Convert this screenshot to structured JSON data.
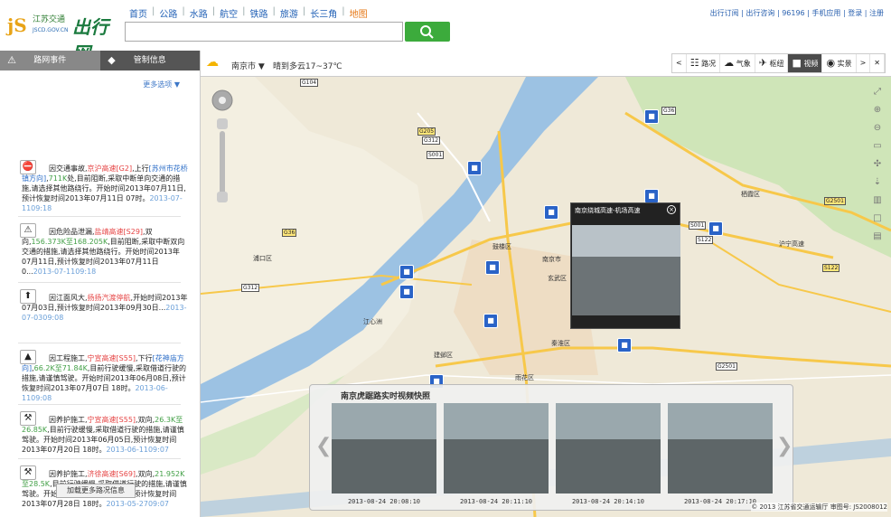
{
  "header": {
    "logo_text": "江苏交通",
    "logo_domain": "JSCD.GOV.CN",
    "logo_big": "出行网",
    "nav": [
      "首页",
      "公路",
      "水路",
      "航空",
      "铁路",
      "旅游",
      "长三角",
      "地图"
    ],
    "toplinks": "出行订阅 | 出行咨询 | 96196 | 手机应用 | 登录 | 注册"
  },
  "sidebar": {
    "tab_road_events": "路网事件",
    "tab_control_info": "管制信息",
    "more_options": "更多选项 ▼",
    "events": [
      {
        "parts": [
          {
            "t": "因交通事故,",
            "c": ""
          },
          {
            "t": "京沪高速[G2]",
            "c": "hl"
          },
          {
            "t": ",上行",
            "c": ""
          },
          {
            "t": "[苏州市花桥镇方向]",
            "c": "bl"
          },
          {
            "t": ",",
            "c": ""
          },
          {
            "t": "711K",
            "c": "gr"
          },
          {
            "t": "处,目前阻断,采取中断单向交通的措施,请选择其他路绕行。开始时间2013年07月11日,预计恢复时间2013年07月11日 07时。",
            "c": ""
          },
          {
            "t": "2013-07-1109:18",
            "c": "dt"
          }
        ]
      },
      {
        "parts": [
          {
            "t": "因危险品泄漏,",
            "c": ""
          },
          {
            "t": "盐靖高速[S29]",
            "c": "hl"
          },
          {
            "t": ",双向,",
            "c": ""
          },
          {
            "t": "156.373K至168.205K",
            "c": "gr"
          },
          {
            "t": ",目前阻断,采取中断双向交通的措施,请选择其他路绕行。开始时间2013年07月11日,预计恢复时间2013年07月11日 0...",
            "c": ""
          },
          {
            "t": "2013-07-1109:18",
            "c": "dt"
          }
        ]
      },
      {
        "parts": [
          {
            "t": "因江面风大,",
            "c": ""
          },
          {
            "t": "扬扬汽渡停航",
            "c": "hl"
          },
          {
            "t": ",开始时间2013年07月03日,预计恢复时间2013年09月30日...",
            "c": ""
          },
          {
            "t": "2013-07-0309:08",
            "c": "dt"
          }
        ]
      },
      {
        "parts": [
          {
            "t": "因工程施工,",
            "c": ""
          },
          {
            "t": "宁宣高速[S55]",
            "c": "hl"
          },
          {
            "t": ",下行",
            "c": ""
          },
          {
            "t": "[花神庙方向]",
            "c": "bl"
          },
          {
            "t": ",",
            "c": ""
          },
          {
            "t": "66.2K至71.84K",
            "c": "gr"
          },
          {
            "t": ",目前行驶缓慢,采取借道行驶的措施,请谨慎驾驶。开始时间2013年06月08日,预计恢复时间2013年07月07日 18时。",
            "c": ""
          },
          {
            "t": "2013-06-1109:08",
            "c": "dt"
          }
        ]
      },
      {
        "parts": [
          {
            "t": "因养护施工,",
            "c": ""
          },
          {
            "t": "宁宣高速[S55]",
            "c": "hl"
          },
          {
            "t": ",双向,",
            "c": ""
          },
          {
            "t": "26.3K至26.85K",
            "c": "gr"
          },
          {
            "t": ",目前行驶缓慢,采取借道行驶的措施,请谨慎驾驶。开始时间2013年06月05日,预计恢复时间2013年07月20日 18时。",
            "c": ""
          },
          {
            "t": "2013-06-1109:07",
            "c": "dt"
          }
        ]
      },
      {
        "parts": [
          {
            "t": "因养护施工,",
            "c": ""
          },
          {
            "t": "济徐高速[S69]",
            "c": "hl"
          },
          {
            "t": ",双向,",
            "c": ""
          },
          {
            "t": "21.952K至28.5K",
            "c": "gr"
          },
          {
            "t": ",目前行驶缓慢,采取借道行驶的措施,请谨慎驾驶。开始时间2013年06月03日,预计恢复时间2013年07月28日 18时。",
            "c": ""
          },
          {
            "t": "2013-05-2709:07",
            "c": "dt"
          }
        ]
      }
    ],
    "load_more": "加载更多路况信息"
  },
  "toolbar": {
    "city": "南京市 ▼",
    "forecast": "晴到多云17~37℃",
    "tools": [
      {
        "label": "路况",
        "icon": "traffic-light-icon",
        "glyph": "☷"
      },
      {
        "label": "气象",
        "icon": "cloud-icon",
        "glyph": "☁"
      },
      {
        "label": "枢纽",
        "icon": "plane-icon",
        "glyph": "✈"
      },
      {
        "label": "视频",
        "icon": "camera-icon",
        "glyph": "■",
        "active": true
      },
      {
        "label": "实景",
        "icon": "pin-icon",
        "glyph": "◉"
      }
    ]
  },
  "map": {
    "popup_title": "南京绕城高速-机场高速",
    "strip_title": "南京虎踞路实时视频快照",
    "timestamps": [
      "2013-08-24 20:08:10",
      "2013-08-24 20:11:10",
      "2013-08-24 20:14:10",
      "2013-08-24 20:17:10"
    ],
    "copyright": "© 2013 江苏省交通运输厅 审图号: JS2008012",
    "places": [
      "栖霞区",
      "鼓楼区",
      "南京市",
      "玄武区",
      "浦口区",
      "建邺区",
      "秦淮区",
      "雨花区",
      "江心洲",
      "沪宁高速"
    ],
    "shields": [
      "G104",
      "G205",
      "G312",
      "S001",
      "G36",
      "G42",
      "S122",
      "G2501",
      "G312",
      "G2501",
      "S122",
      "G36",
      "S001"
    ]
  }
}
